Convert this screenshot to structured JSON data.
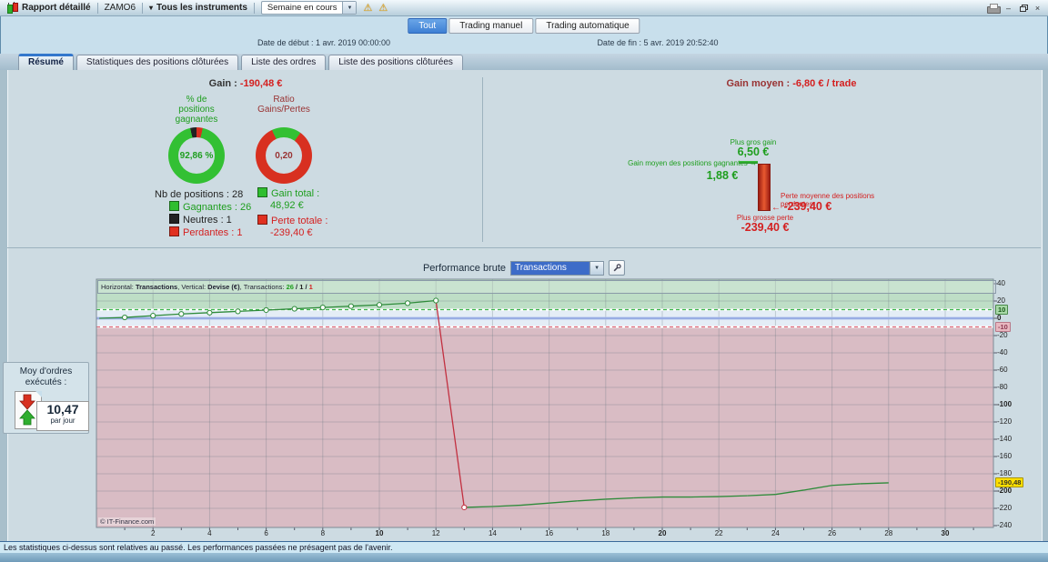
{
  "icons": {
    "warning": "⚠",
    "dropdown": "▼",
    "small_dropdown": "▾",
    "arrow_right": "→",
    "arrow_left": "←",
    "minimize": "–",
    "close": "×"
  },
  "toolbar": {
    "title": "Rapport détaillé",
    "account": "ZAMO6",
    "instruments_dropdown": "Tous les instruments",
    "period_dropdown": "Semaine en cours"
  },
  "view_tabs": {
    "items": [
      {
        "label": "Tout",
        "active": true
      },
      {
        "label": "Trading manuel",
        "active": false
      },
      {
        "label": "Trading automatique",
        "active": false
      }
    ]
  },
  "dates": {
    "start_label": "Date de début : ",
    "start_value": "1 avr. 2019 00:00:00",
    "end_label": "Date de fin : ",
    "end_value": "5 avr. 2019 20:52:40"
  },
  "report_tabs": {
    "items": [
      {
        "label": "Résumé",
        "active": true
      },
      {
        "label": "Statistiques des positions clôturées",
        "active": false
      },
      {
        "label": "Liste des ordres",
        "active": false
      },
      {
        "label": "Liste des positions clôturées",
        "active": false
      }
    ]
  },
  "summary": {
    "gain_label": "Gain : ",
    "gain_value": "-190,48 €",
    "win_donut": {
      "title_lines": [
        "% de",
        "positions",
        "gagnantes"
      ],
      "center": "92,86 %",
      "win_pct": 92.86,
      "neutral_pct": 3.57,
      "loss_pct": 3.57
    },
    "ratio_donut": {
      "title_lines": [
        "Ratio",
        "Gains/Pertes"
      ],
      "center": "0,20",
      "green_fraction": 0.17,
      "start_deg": -25
    },
    "nb_positions_label": "Nb de positions : ",
    "nb_positions": "28",
    "breakdown": [
      {
        "label": "Gagnantes : 26",
        "color": "#2fbe2f",
        "text_color": "#1e9e1e"
      },
      {
        "label": "Neutres : 1",
        "color": "#222222",
        "text_color": "#222222"
      },
      {
        "label": "Perdantes : 1",
        "color": "#e03020",
        "text_color": "#d42020"
      }
    ],
    "totals": [
      {
        "label": "Gain total :",
        "value": "48,92 €",
        "color": "#2fbe2f",
        "text_color": "#1e9e1e"
      },
      {
        "label": "Perte totale :",
        "value": "-239,40 €",
        "color": "#e03020",
        "text_color": "#d42020"
      }
    ]
  },
  "average": {
    "label": "Gain moyen : ",
    "value": "-6,80 € / trade",
    "biggest_gain_label": "Plus gros gain",
    "biggest_gain_value": "6,50 €",
    "biggest_gain": 6.5,
    "avg_win_label": "Gain moyen des positions gagnantes",
    "avg_win_value": "1,88 €",
    "avg_win": 1.88,
    "avg_loss_label": "Perte moyenne des positions perdantes",
    "avg_loss_value": "-239,40 €",
    "biggest_loss_label": "Plus grosse perte",
    "biggest_loss_value": "-239,40 €",
    "biggest_loss": -239.4
  },
  "orders_box": {
    "title_line1": "Moy d'ordres",
    "title_line2": "exécutés :",
    "value": "10,47",
    "unit": "par jour"
  },
  "performance": {
    "label": "Performance brute",
    "selected_option": "Transactions"
  },
  "chart_data": {
    "type": "line",
    "title": "Performance brute",
    "xlabel": "Transactions",
    "ylabel": "Devise (€)",
    "legend": {
      "h_label": "Horizontal: ",
      "h_value": "Transactions",
      "sep1": ", ",
      "v_label": "Vertical: ",
      "v_value": "Devise (€)",
      "sep2": ", ",
      "c_label": "Transactions: ",
      "wins": "26",
      "slash": " / ",
      "neutrals": "1",
      "losses": "1"
    },
    "points": [
      [
        0.1,
        0
      ],
      [
        1,
        1.0
      ],
      [
        2,
        3.0
      ],
      [
        3,
        5.0
      ],
      [
        4,
        6.5
      ],
      [
        5,
        8.0
      ],
      [
        6,
        9.5
      ],
      [
        7,
        11.0
      ],
      [
        8,
        12.5
      ],
      [
        9,
        14.0
      ],
      [
        10,
        15.5
      ],
      [
        11,
        17.5
      ],
      [
        12,
        20.5
      ],
      [
        13,
        -218.9
      ],
      [
        14,
        -217.9
      ],
      [
        15,
        -216.4
      ],
      [
        16,
        -213.9
      ],
      [
        17,
        -211.4
      ],
      [
        18,
        -209.4
      ],
      [
        19,
        -207.9
      ],
      [
        20,
        -206.9
      ],
      [
        21,
        -206.9
      ],
      [
        22,
        -206.4
      ],
      [
        23,
        -205.4
      ],
      [
        24,
        -203.9
      ],
      [
        25,
        -198.9
      ],
      [
        26,
        -193.4
      ],
      [
        27,
        -191.5
      ],
      [
        28,
        -190.48
      ]
    ],
    "final_value": -190.48,
    "markers_through_x": 13,
    "drop_at_x": 13,
    "upper_threshold": 10,
    "lower_threshold": -10,
    "xlim": [
      0,
      31.7
    ],
    "ylim": [
      -242,
      45.3
    ],
    "x_ticks": [
      2,
      4,
      6,
      8,
      10,
      12,
      14,
      16,
      18,
      20,
      22,
      24,
      26,
      28,
      30
    ],
    "x_ticks_bold": [
      10,
      20,
      30
    ],
    "y_tick_items": [
      {
        "v": 40
      },
      {
        "v": 20
      },
      {
        "v": 0,
        "bold": true
      },
      {
        "v": -20
      },
      {
        "v": -40
      },
      {
        "v": -60
      },
      {
        "v": -80
      },
      {
        "v": -100,
        "bold": true
      },
      {
        "v": -120
      },
      {
        "v": -140
      },
      {
        "v": -160
      },
      {
        "v": -180
      },
      {
        "v": -200,
        "bold": true
      },
      {
        "v": -220
      },
      {
        "v": -240
      }
    ],
    "axis_boxes": [
      {
        "v": 10,
        "label": "10",
        "style": "green"
      },
      {
        "v": -10,
        "label": "-10",
        "style": "pink"
      },
      {
        "v": -190.48,
        "label": "-190,48",
        "style": "yellow"
      }
    ],
    "watermark": "© IT-Finance.com",
    "colors": {
      "line": "#2e8b3a",
      "drop": "#c23040",
      "band_green": "#bedec6",
      "band_pink": "#d9bcc4",
      "band_mid": "#e4edf6",
      "zero_line": "#8098d8",
      "grid": "rgba(110,120,130,0.32)"
    }
  },
  "footer": {
    "text": "Les statistiques ci-dessus sont relatives au passé. Les performances passées ne présagent pas de l'avenir."
  }
}
